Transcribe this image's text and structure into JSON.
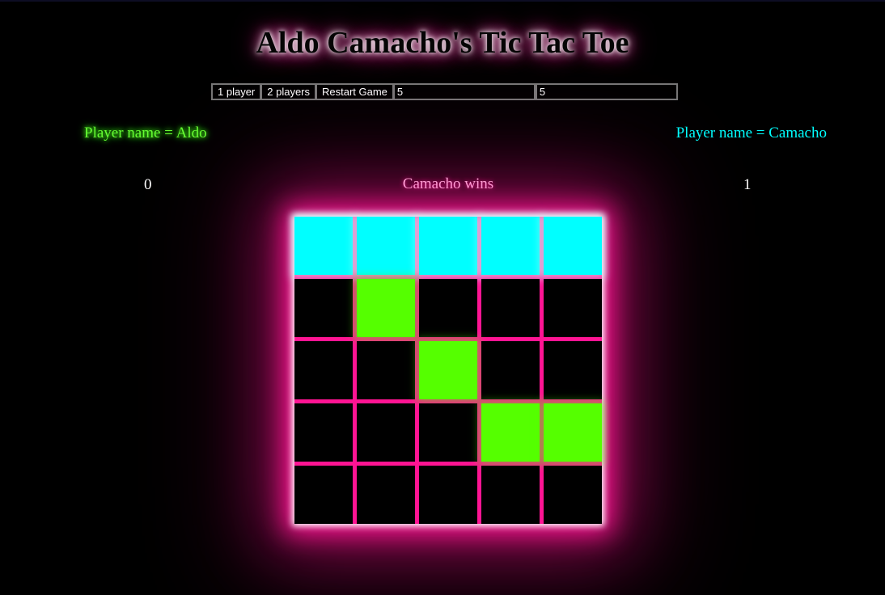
{
  "title": "Aldo Camacho's Tic Tac Toe",
  "controls": {
    "one_player_label": "1 player",
    "two_players_label": "2 players",
    "restart_label": "Restart Game",
    "board_size_value": "5",
    "win_length_value": "5"
  },
  "players": {
    "p1_name": "Player name = Aldo",
    "p2_name": "Player name = Camacho",
    "p1_score": "0",
    "p2_score": "1"
  },
  "status": "Camacho wins",
  "colors": {
    "accent": "#ff1493",
    "player1": "#55ff00",
    "player2": "#00ffff",
    "background": "#000000"
  },
  "board": [
    [
      "o",
      "o",
      "o",
      "o",
      "o"
    ],
    [
      "",
      "x",
      "",
      "",
      ""
    ],
    [
      "",
      "",
      "x",
      "",
      ""
    ],
    [
      "",
      "",
      "",
      "x",
      "x"
    ],
    [
      "",
      "",
      "",
      "",
      ""
    ]
  ]
}
